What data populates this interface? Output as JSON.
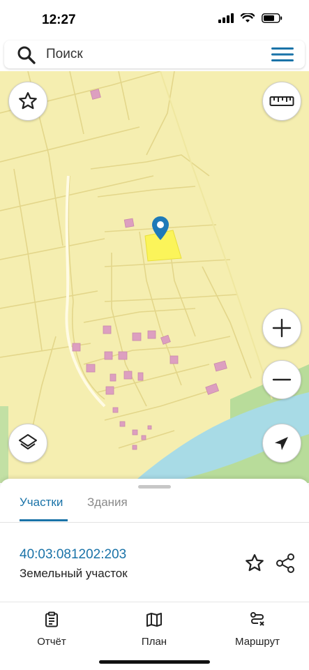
{
  "status": {
    "time": "12:27"
  },
  "search": {
    "placeholder": "Поиск"
  },
  "icons": {
    "search": "search-icon",
    "menu": "hamburger-menu-icon",
    "favorites": "star-outline-icon",
    "ruler": "ruler-icon",
    "zoom_in": "plus-icon",
    "zoom_out": "minus-icon",
    "layers": "layers-icon",
    "locate": "navigation-arrow-icon",
    "map_pin": "map-pin-icon"
  },
  "sheet": {
    "tabs": [
      {
        "label": "Участки",
        "active": true
      },
      {
        "label": "Здания",
        "active": false
      }
    ],
    "parcel": {
      "cadastral_number": "40:03:081202:203",
      "type": "Земельный участок"
    }
  },
  "nav": {
    "items": [
      {
        "label": "Отчёт",
        "icon": "clipboard-icon"
      },
      {
        "label": "План",
        "icon": "map-icon"
      },
      {
        "label": "Маршрут",
        "icon": "route-icon"
      }
    ]
  },
  "colors": {
    "accent": "#1a73a8",
    "map_land": "#f5eeb0",
    "map_lines": "#e3d68a",
    "selected_parcel": "#fbf45a",
    "building": "#dd9fc0",
    "water": "#a8dbe6",
    "greenery": "#b8dc9a"
  }
}
